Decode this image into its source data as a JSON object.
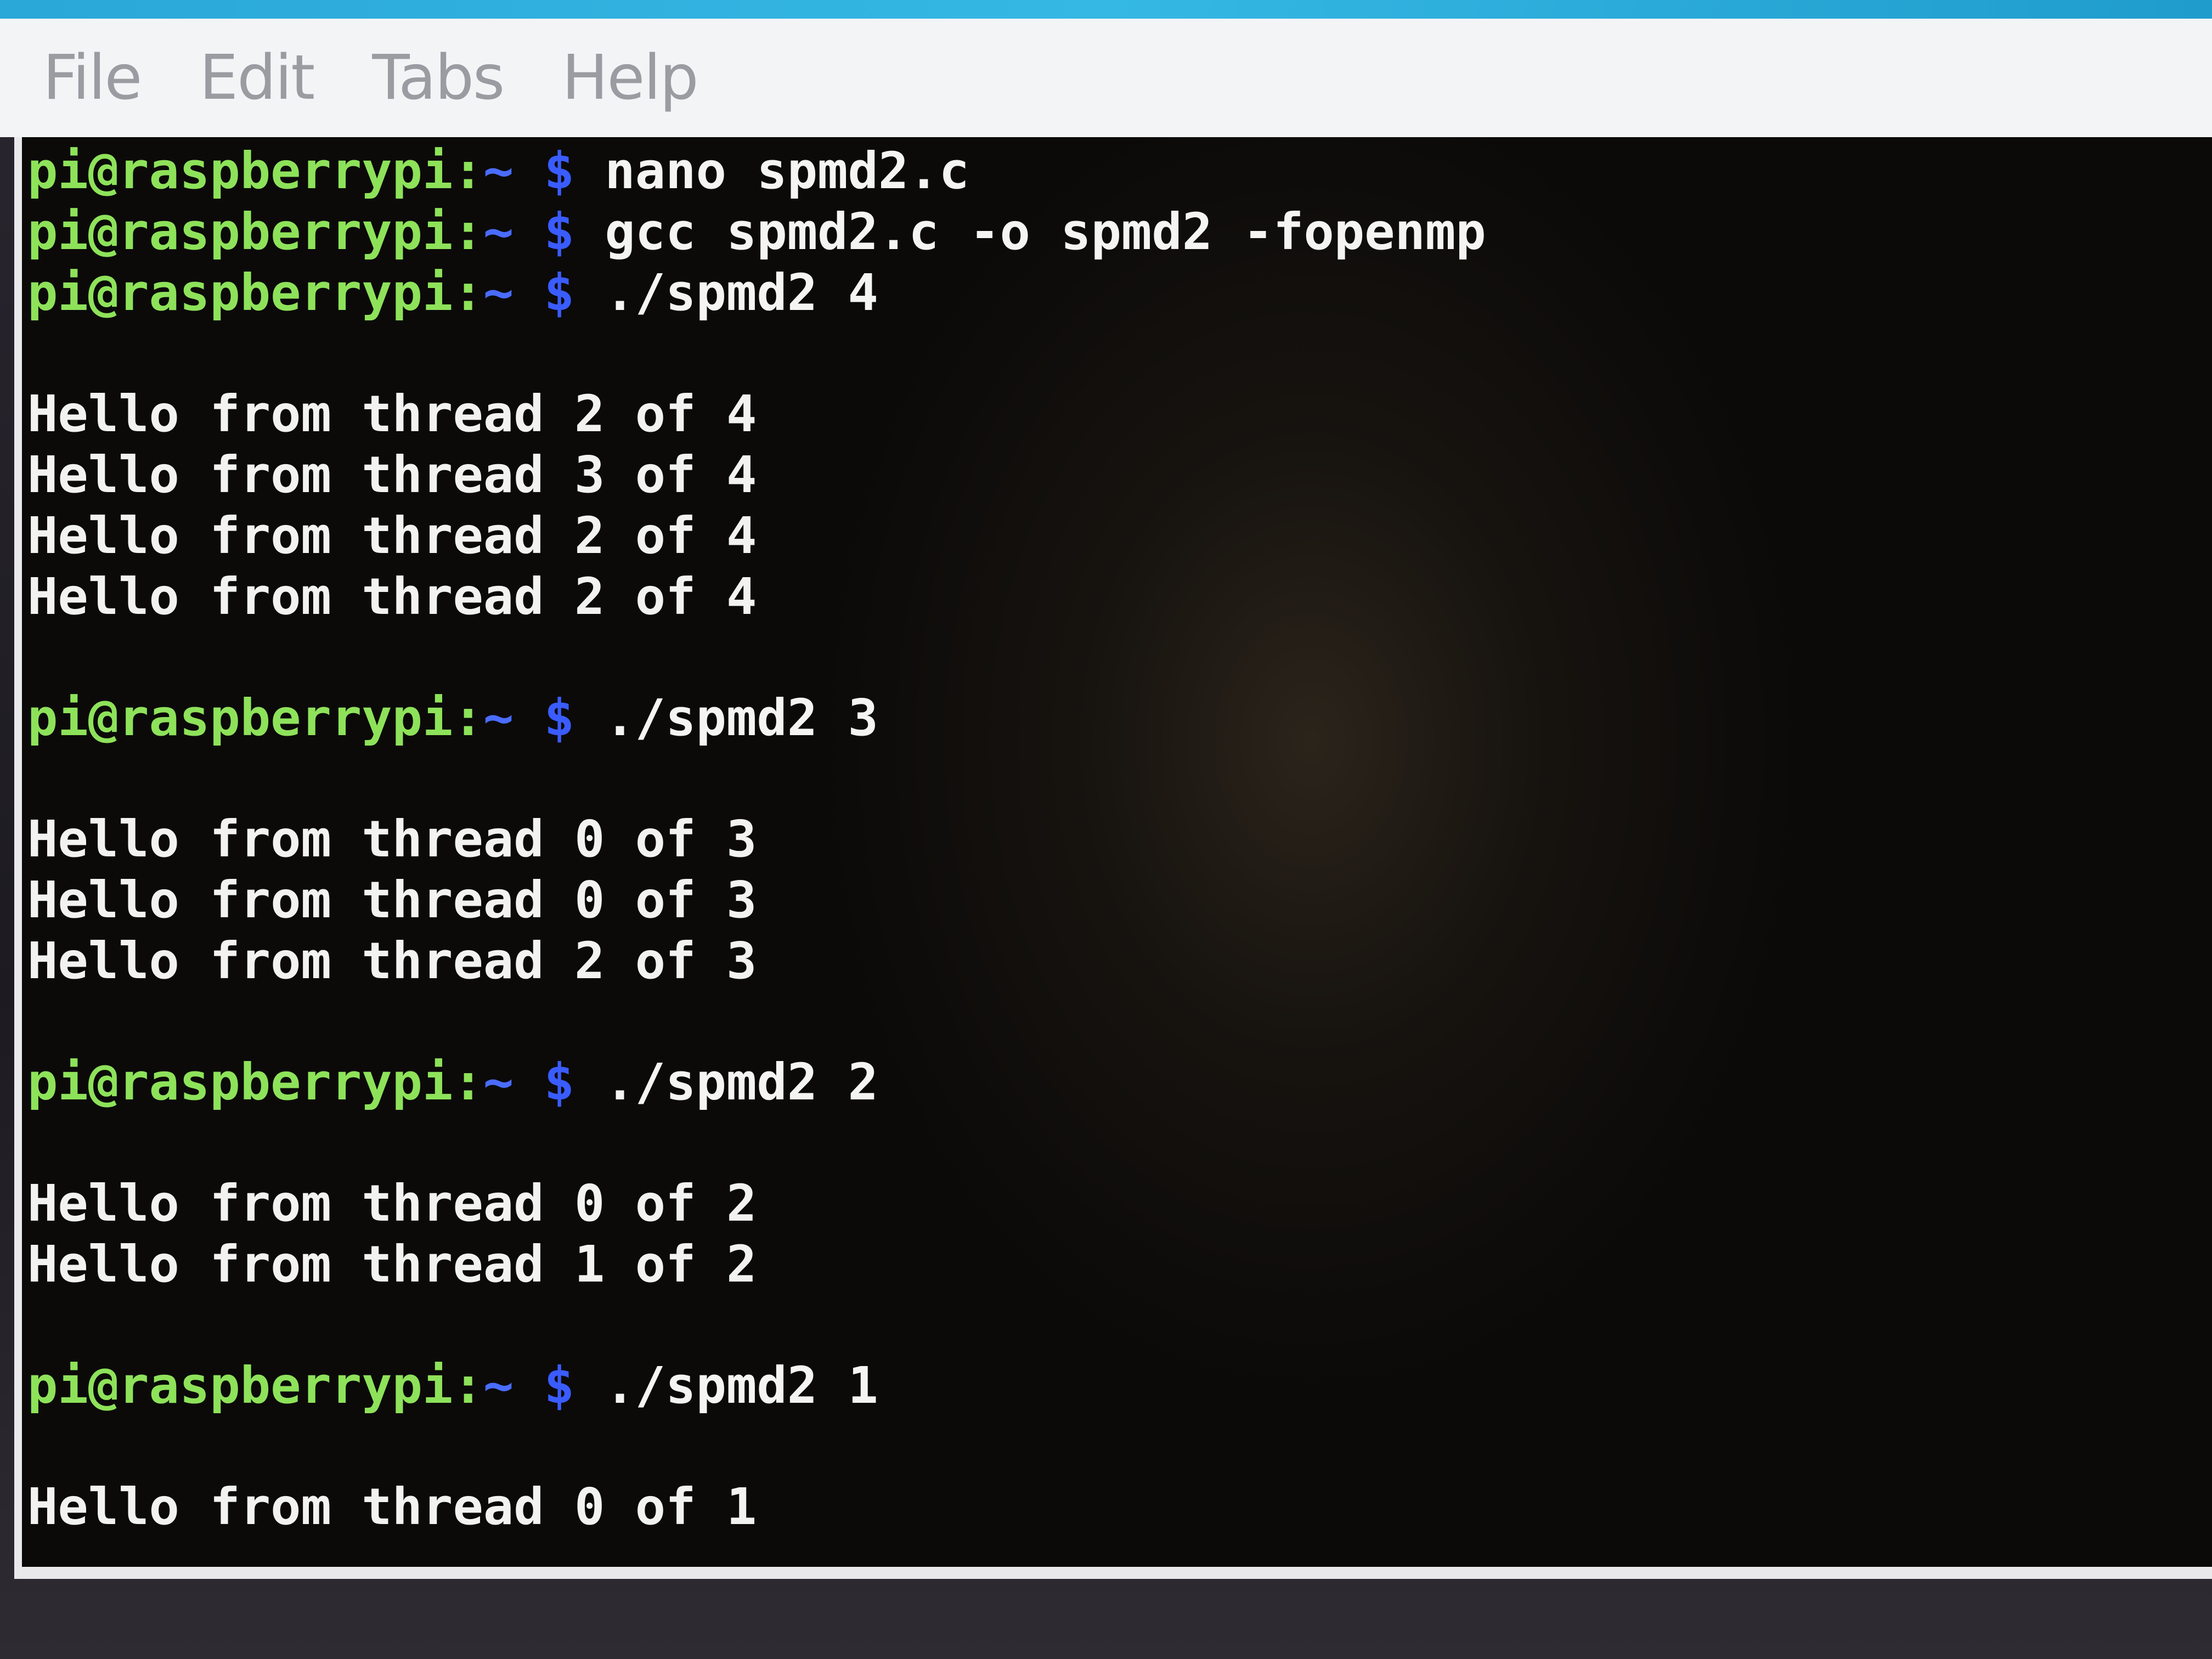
{
  "window": {
    "title": ""
  },
  "menu": {
    "items": [
      "File",
      "Edit",
      "Tabs",
      "Help"
    ]
  },
  "colors": {
    "prompt_user": "#8ee25a",
    "prompt_path": "#4a6cff",
    "terminal_text": "#f4f4f2",
    "terminal_bg": "#0b0a09",
    "menubar_bg": "#f3f4f6",
    "titlebar": "#2aa8d8"
  },
  "terminal": {
    "prompt": {
      "user_host": "pi@raspberrypi",
      "separator": ":",
      "path": "~",
      "sign": "$"
    },
    "commands": [
      "nano spmd2.c",
      "gcc spmd2.c -o spmd2 -fopenmp",
      "./spmd2 4",
      "./spmd2 3",
      "./spmd2 2",
      "./spmd2 1"
    ],
    "outputs": {
      "run4": [
        "Hello from thread 2 of 4",
        "Hello from thread 3 of 4",
        "Hello from thread 2 of 4",
        "Hello from thread 2 of 4"
      ],
      "run3": [
        "Hello from thread 0 of 3",
        "Hello from thread 0 of 3",
        "Hello from thread 2 of 3"
      ],
      "run2": [
        "Hello from thread 0 of 2",
        "Hello from thread 1 of 2"
      ],
      "run1": [
        "Hello from thread 0 of 1"
      ]
    }
  }
}
